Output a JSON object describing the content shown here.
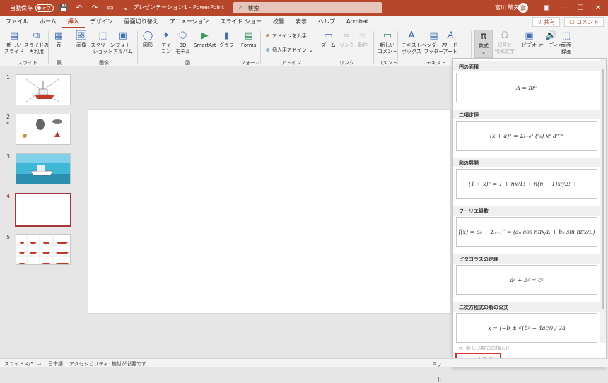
{
  "titlebar": {
    "autosave_label": "自動保存",
    "autosave_state": "オフ",
    "title": "プレゼンテーション1 - PowerPoint",
    "search_placeholder": "検索",
    "user_name": "富川 晴美",
    "avatar_initial": "富",
    "icons": [
      "save-icon",
      "undo-icon",
      "redo-icon",
      "present-icon",
      "customize-icon",
      "search-icon",
      "minimize-icon",
      "restore-icon",
      "close-icon"
    ]
  },
  "tabs": {
    "items": [
      "ファイル",
      "ホーム",
      "挿入",
      "デザイン",
      "画面切り替え",
      "アニメーション",
      "スライド ショー",
      "校閲",
      "表示",
      "ヘルプ",
      "Acrobat"
    ],
    "active_index": 2,
    "share_label": "共有",
    "comment_label": "コメント"
  },
  "ribbon": {
    "buttons": {
      "new_slide": "新しい\nスライド",
      "reuse_slide": "スライドの\n再利用",
      "table": "表",
      "images": "画像",
      "screenshot": "スクリーン\nショット",
      "photo_album": "フォト\nアルバム",
      "shapes": "図形",
      "icons": "アイ\nコン",
      "models_3d": "3D\nモデル",
      "smartart": "SmartArt",
      "chart": "グラフ",
      "forms": "Forms",
      "get_addins": "アドインを入手",
      "my_addins": "個人用アドイン",
      "zoom": "ズーム",
      "link": "リンク",
      "action": "動作",
      "new_comment": "新しい\nコメント",
      "textbox": "テキスト\nボックス",
      "header_footer": "ヘッダーと\nフッター",
      "wordart": "ワード\nアート",
      "equation": "数式",
      "symbol": "記号と\n特殊文字",
      "video": "ビデオ",
      "audio": "オーディオ",
      "screen_recording": "画面\n録画"
    },
    "groups": {
      "slides": "スライド",
      "table": "表",
      "images": "画像",
      "illustrations": "図",
      "forms": "フォーム",
      "addins": "アドイン",
      "links": "リンク",
      "comments": "コメント",
      "text": "テキスト"
    }
  },
  "slides_panel": {
    "slides": [
      {
        "number": "1",
        "marker": ""
      },
      {
        "number": "2",
        "marker": "*"
      },
      {
        "number": "3",
        "marker": ""
      },
      {
        "number": "4",
        "marker": ""
      },
      {
        "number": "5",
        "marker": ""
      }
    ],
    "selected_index": 3
  },
  "equation_gallery": {
    "items": [
      {
        "title": "円の面積",
        "formula": "A = πr²"
      },
      {
        "title": "二項定理",
        "formula": "(x + a)ⁿ = Σₖ₌₀ⁿ (ⁿₖ) xᵏ aⁿ⁻ᵏ"
      },
      {
        "title": "和の展開",
        "formula": "(1 + x)ⁿ = 1 + nx/1! + n(n − 1)x²/2! + ⋯"
      },
      {
        "title": "フーリエ級数",
        "formula": "f(x) = a₀ + Σₙ₌₁^∞ (aₙ cos nπx/L + bₙ sin nπx/L)"
      },
      {
        "title": "ピタゴラスの定理",
        "formula": "a² + b² = c²"
      },
      {
        "title": "二次方程式の解の公式",
        "formula": "x = (−b ± √(b² − 4ac)) / 2a"
      }
    ],
    "insert_new_label": "新しい数式の挿入(I)",
    "ink_equation_label": "インク数式(K)"
  },
  "statusbar": {
    "slide_position": "スライド 4/5",
    "language": "日本語",
    "accessibility": "アクセシビリティ: 検討が必要です",
    "notes": "ノート"
  },
  "colors": {
    "accent": "#b7472a",
    "highlight_box": "#e0302c"
  }
}
